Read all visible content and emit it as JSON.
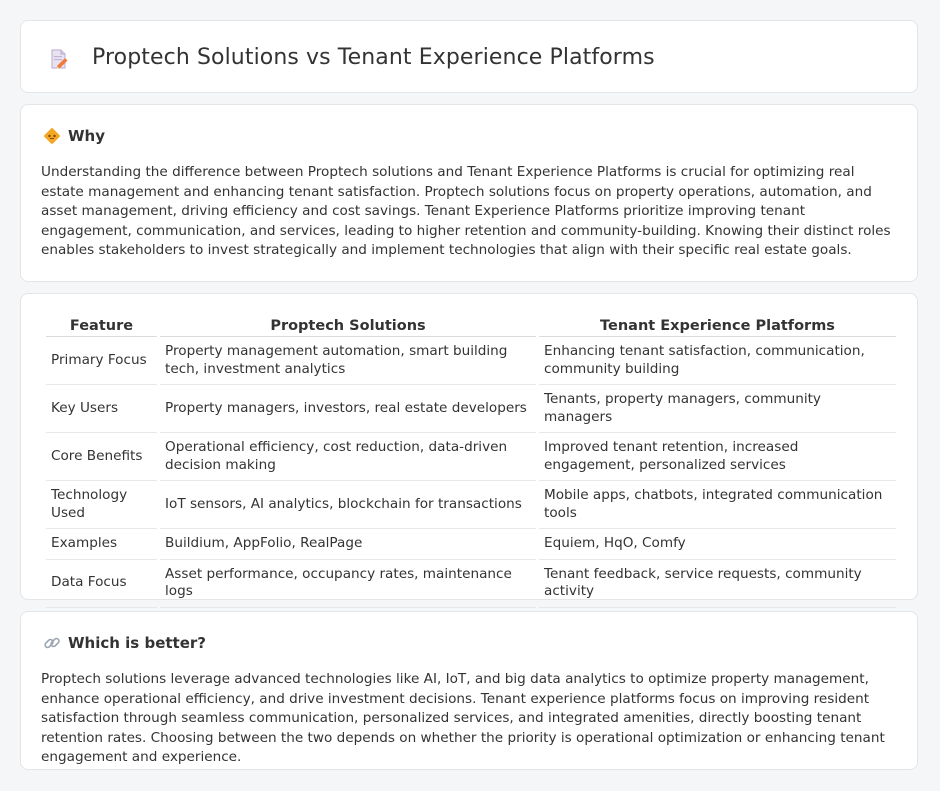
{
  "header": {
    "title": "Proptech Solutions vs Tenant Experience Platforms",
    "icon": "document-pencil-icon"
  },
  "why": {
    "heading": "Why",
    "icon": "diamond-sign-icon",
    "text": "Understanding the difference between Proptech solutions and Tenant Experience Platforms is crucial for optimizing real estate management and enhancing tenant satisfaction. Proptech solutions focus on property operations, automation, and asset management, driving efficiency and cost savings. Tenant Experience Platforms prioritize improving tenant engagement, communication, and services, leading to higher retention and community-building. Knowing their distinct roles enables stakeholders to invest strategically and implement technologies that align with their specific real estate goals."
  },
  "table": {
    "headers": [
      "Feature",
      "Proptech Solutions",
      "Tenant Experience Platforms"
    ],
    "rows": [
      [
        "Primary Focus",
        "Property management automation, smart building tech, investment analytics",
        "Enhancing tenant satisfaction, communication, community building"
      ],
      [
        "Key Users",
        "Property managers, investors, real estate developers",
        "Tenants, property managers, community managers"
      ],
      [
        "Core Benefits",
        "Operational efficiency, cost reduction, data-driven decision making",
        "Improved tenant retention, increased engagement, personalized services"
      ],
      [
        "Technology Used",
        "IoT sensors, AI analytics, blockchain for transactions",
        "Mobile apps, chatbots, integrated communication tools"
      ],
      [
        "Examples",
        "Buildium, AppFolio, RealPage",
        "Equiem, HqO, Comfy"
      ],
      [
        "Data Focus",
        "Asset performance, occupancy rates, maintenance logs",
        "Tenant feedback, service requests, community activity"
      ]
    ]
  },
  "better": {
    "heading": "Which is better?",
    "icon": "link-icon",
    "text": "Proptech solutions leverage advanced technologies like AI, IoT, and big data analytics to optimize property management, enhance operational efficiency, and drive investment decisions. Tenant experience platforms focus on improving resident satisfaction through seamless communication, personalized services, and integrated amenities, directly boosting tenant retention rates. Choosing between the two depends on whether the priority is operational optimization or enhancing tenant engagement and experience."
  },
  "colors": {
    "background": "#f5f6f8",
    "card": "#ffffff",
    "accent": "#f0a030",
    "text": "#333333"
  }
}
